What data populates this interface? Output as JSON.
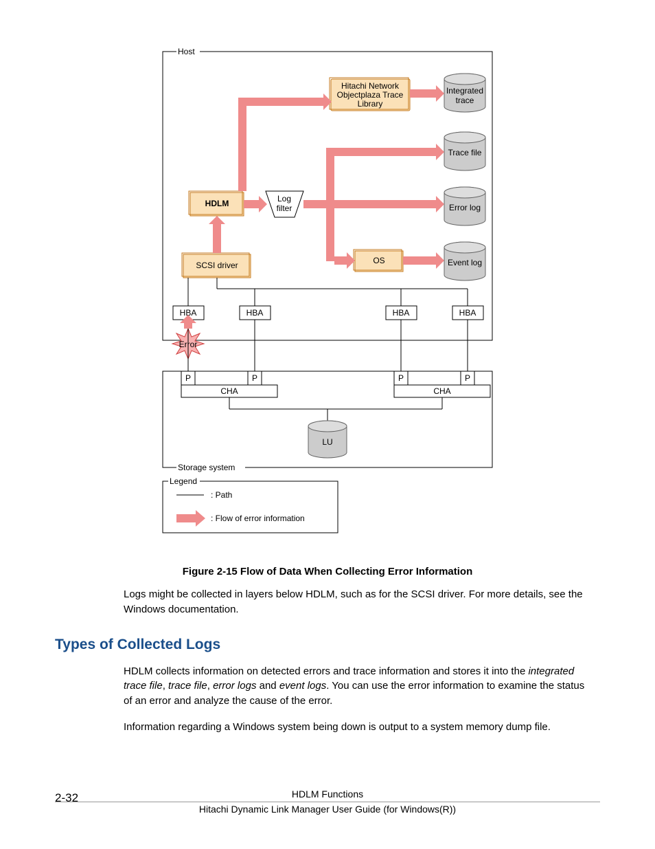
{
  "diagram": {
    "host_label": "Host",
    "hitachi_trace_lib_l1": "Hitachi Network",
    "hitachi_trace_lib_l2": "Objectplaza Trace",
    "hitachi_trace_lib_l3": "Library",
    "integrated_trace_l1": "Integrated",
    "integrated_trace_l2": "trace",
    "trace_file": "Trace file",
    "hdlm": "HDLM",
    "log_filter_l1": "Log",
    "log_filter_l2": "filter",
    "error_log": "Error log",
    "scsi_driver": "SCSI driver",
    "os": "OS",
    "event_log": "Event log",
    "hba": "HBA",
    "error_star": "Error",
    "p": "P",
    "cha": "CHA",
    "lu": "LU",
    "storage_system_label": "Storage system",
    "legend_title": "Legend",
    "legend_path": ": Path",
    "legend_flow": ": Flow of error information"
  },
  "figure_caption": "Figure 2-15 Flow of Data When Collecting Error Information",
  "para1": "Logs might be collected in layers below HDLM, such as for the SCSI driver. For more details, see the Windows documentation.",
  "section_heading": "Types of Collected Logs",
  "para2_pre": "HDLM collects information on detected errors and trace information and stores it into the ",
  "para2_em1": "integrated trace file",
  "para2_c1": ", ",
  "para2_em2": "trace file",
  "para2_c2": ", ",
  "para2_em3": "error logs",
  "para2_c3": " and ",
  "para2_em4": "event logs",
  "para2_post": ". You can use the error information to examine the status of an error and analyze the cause of the error.",
  "para3": "Information regarding a Windows system being down is output to a system memory dump file.",
  "footer": {
    "page_number": "2-32",
    "chapter": "HDLM Functions",
    "book": "Hitachi Dynamic Link Manager User Guide (for Windows(R))"
  }
}
